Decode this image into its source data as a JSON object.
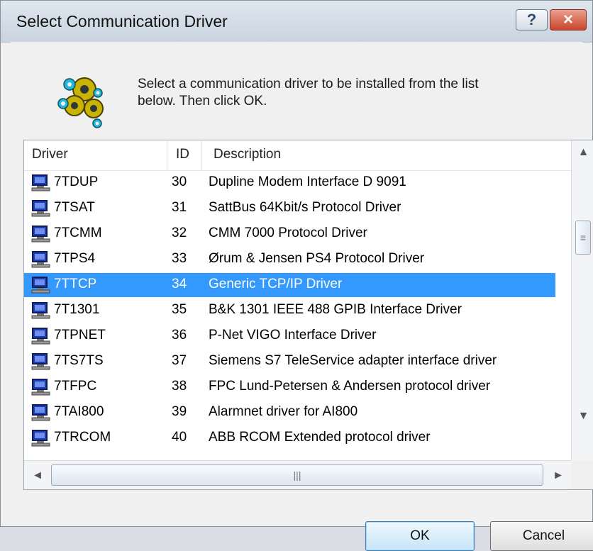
{
  "window": {
    "title": "Select Communication Driver",
    "help_label": "?",
    "close_label": "×"
  },
  "instruction": "Select a communication driver to be installed from the list\nbelow. Then click OK.",
  "columns": {
    "driver": "Driver",
    "id": "ID",
    "description": "Description"
  },
  "rows": [
    {
      "driver": "7TDUP",
      "id": "30",
      "description": "Dupline Modem Interface D 9091"
    },
    {
      "driver": "7TSAT",
      "id": "31",
      "description": "SattBus 64Kbit/s Protocol Driver"
    },
    {
      "driver": "7TCMM",
      "id": "32",
      "description": "CMM 7000 Protocol Driver"
    },
    {
      "driver": "7TPS4",
      "id": "33",
      "description": "Ørum & Jensen PS4 Protocol Driver"
    },
    {
      "driver": "7TTCP",
      "id": "34",
      "description": "Generic TCP/IP Driver",
      "selected": true
    },
    {
      "driver": "7T1301",
      "id": "35",
      "description": "B&K 1301 IEEE 488 GPIB Interface Driver"
    },
    {
      "driver": "7TPNET",
      "id": "36",
      "description": "P-Net VIGO Interface Driver"
    },
    {
      "driver": "7TS7TS",
      "id": "37",
      "description": "Siemens S7 TeleService adapter interface driver"
    },
    {
      "driver": "7TFPC",
      "id": "38",
      "description": "FPC Lund-Petersen & Andersen protocol driver"
    },
    {
      "driver": "7TAI800",
      "id": "39",
      "description": "Alarmnet driver for AI800"
    },
    {
      "driver": "7TRCOM",
      "id": "40",
      "description": "ABB RCOM Extended protocol driver"
    }
  ],
  "scrollbar": {
    "up_arrow": "▲",
    "down_arrow": "▼",
    "left_arrow": "◄",
    "right_arrow": "►",
    "vertical_grip": "≡",
    "horizontal_grip": "|||"
  },
  "buttons": {
    "ok": "OK",
    "cancel": "Cancel"
  },
  "colors": {
    "selection": "#3399ff",
    "background": "#f0f0f0"
  },
  "icons": {
    "main": "gear-cluster-icon",
    "driver": "computer-icon"
  }
}
